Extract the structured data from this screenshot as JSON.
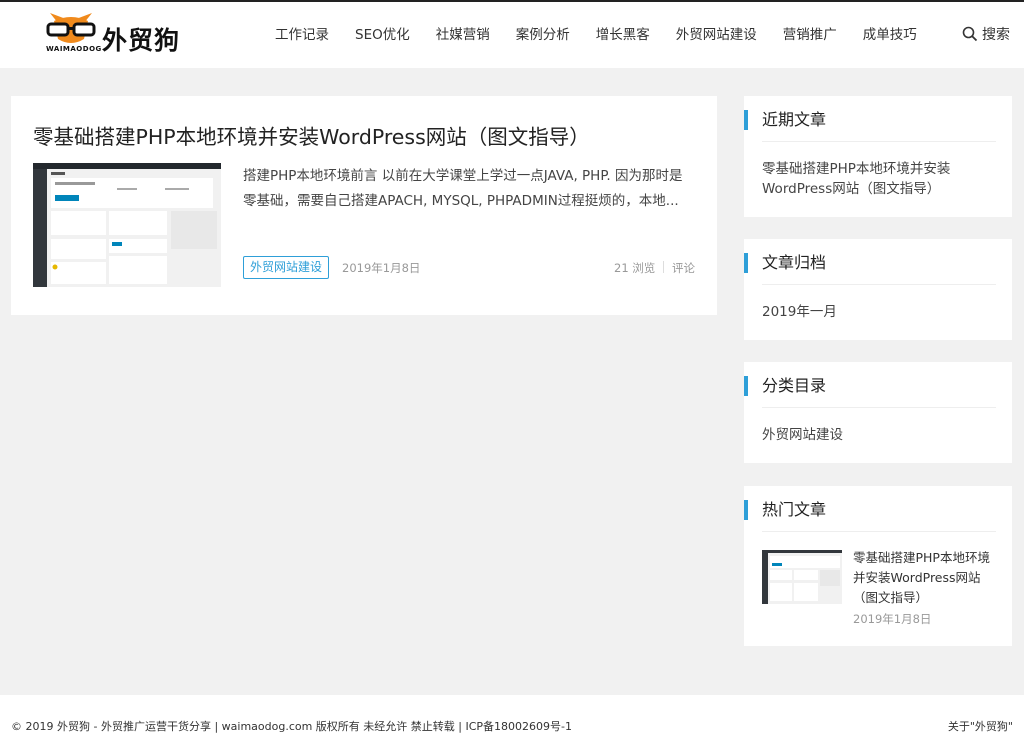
{
  "logo": {
    "text": "外贸狗",
    "sub": "WAIMAODOG"
  },
  "nav": {
    "items": [
      "工作记录",
      "SEO优化",
      "社媒营销",
      "案例分析",
      "增长黑客",
      "外贸网站建设",
      "营销推广",
      "成单技巧"
    ]
  },
  "search": {
    "label": "搜索"
  },
  "post": {
    "title": "零基础搭建PHP本地环境并安装WordPress网站（图文指导）",
    "excerpt": "搭建PHP本地环境前言 以前在大学课堂上学过一点JAVA, PHP. 因为那时是零基础，需要自己搭建APACH, MYSQL, PHPADMIN过程挺烦的，本地...",
    "tag": "外贸网站建设",
    "date": "2019年1月8日",
    "views": "21 浏览",
    "comments": "评论"
  },
  "widgets": {
    "recent": {
      "title": "近期文章",
      "item": "零基础搭建PHP本地环境并安装WordPress网站（图文指导）"
    },
    "archive": {
      "title": "文章归档",
      "item": "2019年一月"
    },
    "category": {
      "title": "分类目录",
      "item": "外贸网站建设"
    },
    "hot": {
      "title": "热门文章",
      "item": "零基础搭建PHP本地环境并安装WordPress网站（图文指导）",
      "date": "2019年1月8日"
    }
  },
  "footer": {
    "left": "© 2019 外贸狗 - 外贸推广运营干货分享 | waimaodog.com 版权所有 未经允许 禁止转载 | ICP备18002609号-1",
    "right": "关于\"外贸狗\""
  },
  "colors": {
    "accent": "#2e9fd8",
    "background": "#f1f1f1"
  }
}
